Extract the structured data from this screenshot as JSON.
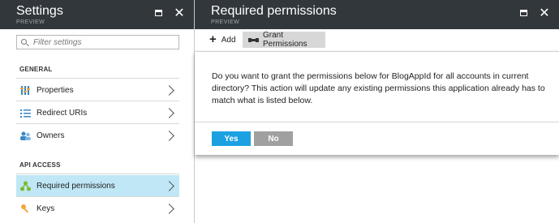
{
  "settings": {
    "title": "Settings",
    "subtitle": "PREVIEW",
    "search_placeholder": "Filter settings",
    "general_label": "GENERAL",
    "api_label": "API ACCESS",
    "items": [
      {
        "label": "Properties",
        "icon": "properties-icon"
      },
      {
        "label": "Redirect URIs",
        "icon": "list-icon"
      },
      {
        "label": "Owners",
        "icon": "people-icon"
      },
      {
        "label": "Required permissions",
        "icon": "permissions-icon"
      },
      {
        "label": "Keys",
        "icon": "key-icon"
      }
    ]
  },
  "permissions": {
    "title": "Required permissions",
    "subtitle": "PREVIEW",
    "toolbar": {
      "add_label": "Add",
      "grant_label": "Grant Permissions"
    },
    "dialog": {
      "message": "Do you want to grant the permissions below for BlogAppId for all accounts in current directory? This action will update any existing permissions this application already has to match what is listed below.",
      "yes_label": "Yes",
      "no_label": "No"
    }
  },
  "colors": {
    "header": "#32373c",
    "accent_blue": "#1ba1e2",
    "selected_bg": "#bfe7f5",
    "no_button": "#a0a0a0"
  }
}
